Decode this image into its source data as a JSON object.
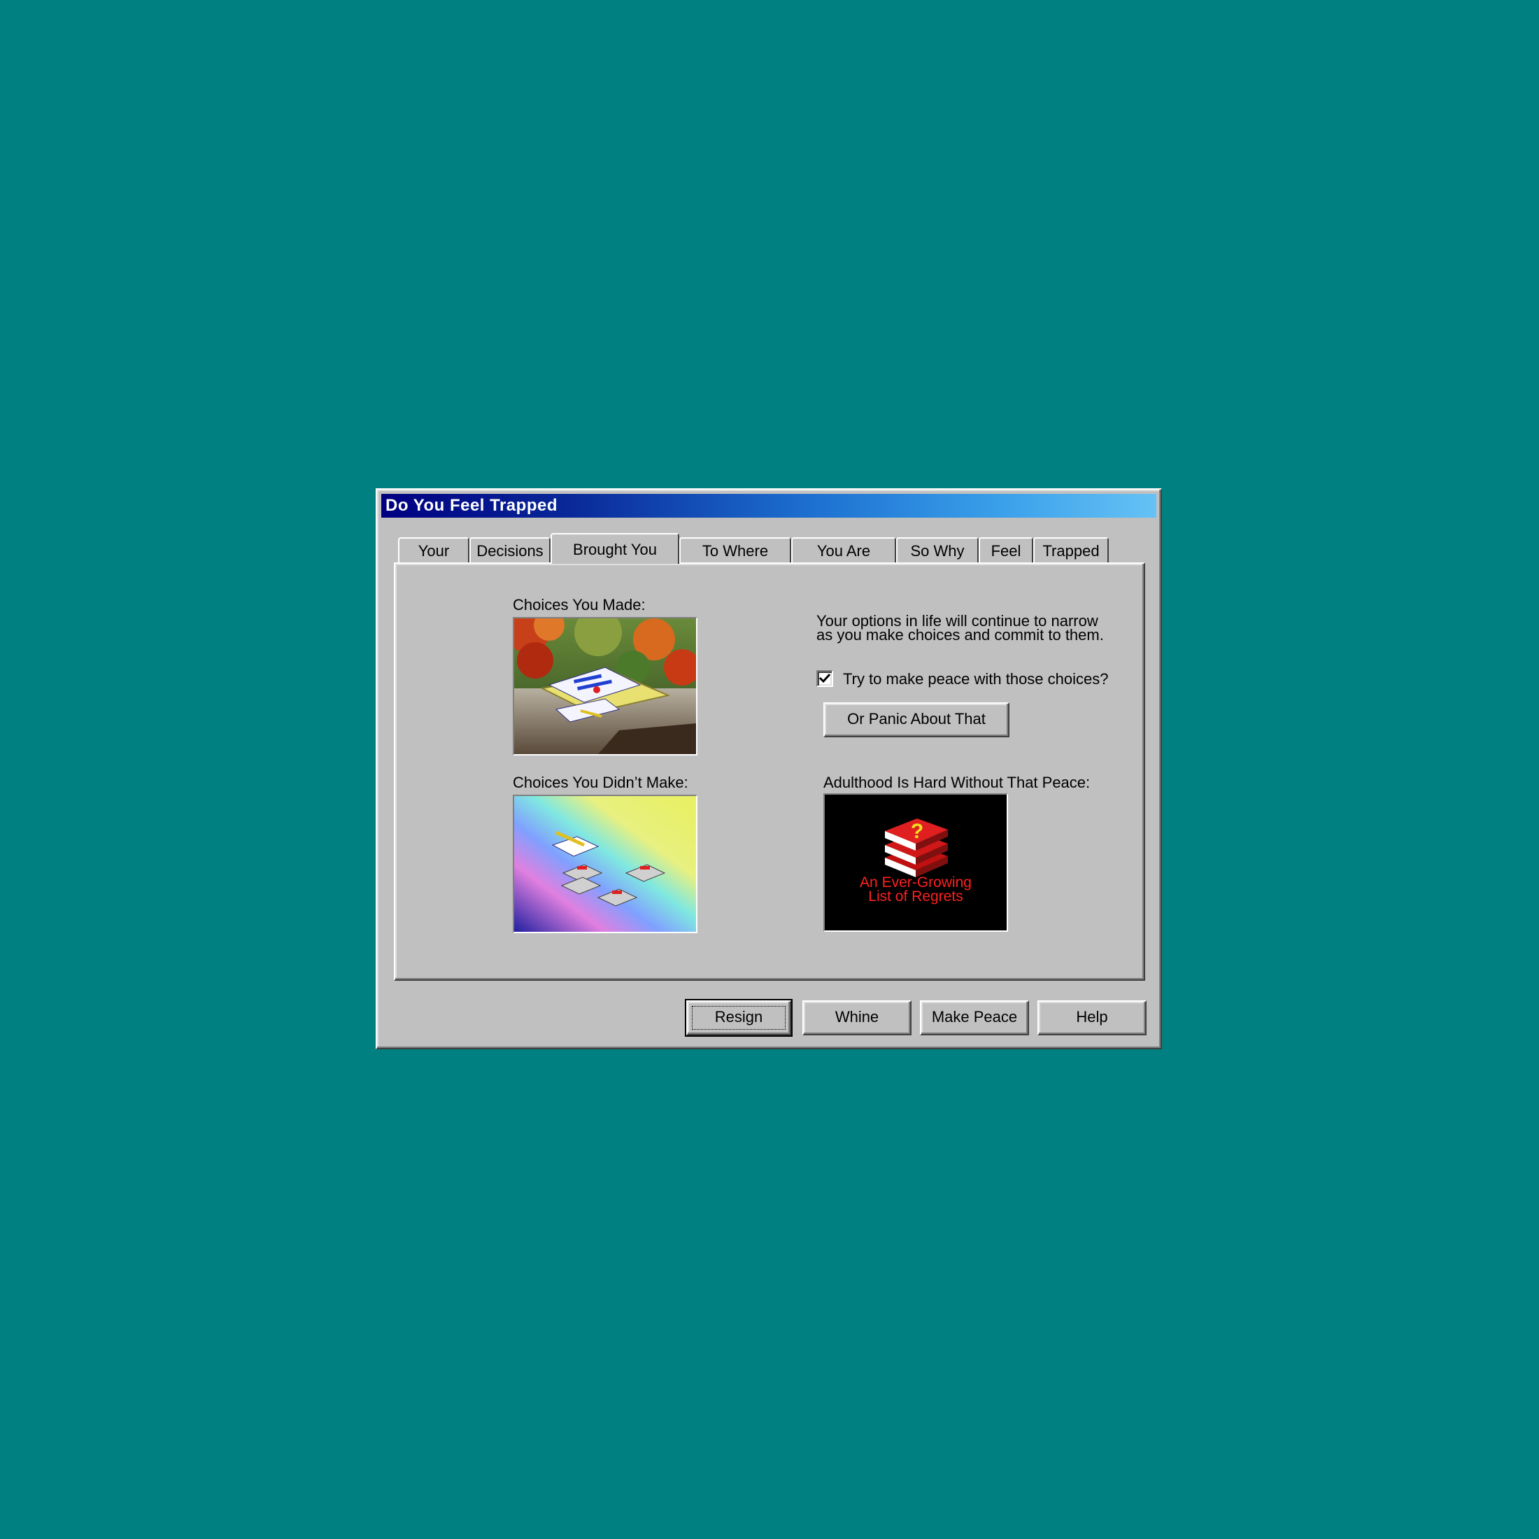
{
  "window": {
    "title": "Do You Feel Trapped"
  },
  "tabs": [
    {
      "label": "Your"
    },
    {
      "label": "Decisions"
    },
    {
      "label": "Brought You",
      "active": true
    },
    {
      "label": "To Where"
    },
    {
      "label": "You Are"
    },
    {
      "label": "So Why"
    },
    {
      "label": "Feel"
    },
    {
      "label": "Trapped"
    }
  ],
  "panel": {
    "choices_made_label": "Choices You Made:",
    "choices_not_made_label": "Choices You Didn’t Make:",
    "options_text_line1": "Your options in life will continue to narrow",
    "options_text_line2": "as you make choices and commit to them.",
    "checkbox_label": "Try to make peace with those choices?",
    "checkbox_checked": true,
    "panic_button": "Or Panic About That",
    "adulthood_label": "Adulthood Is Hard Without That Peace:",
    "regrets_line1": "An Ever-Growing",
    "regrets_line2": "List of Regrets"
  },
  "buttons": {
    "resign": "Resign",
    "whine": "Whine",
    "make_peace": "Make Peace",
    "help": "Help"
  },
  "colors": {
    "desktop": "#008080",
    "face": "#c0c0c0",
    "title_start": "#000080",
    "title_end": "#66c2f5",
    "regret_text": "#ff2020"
  }
}
